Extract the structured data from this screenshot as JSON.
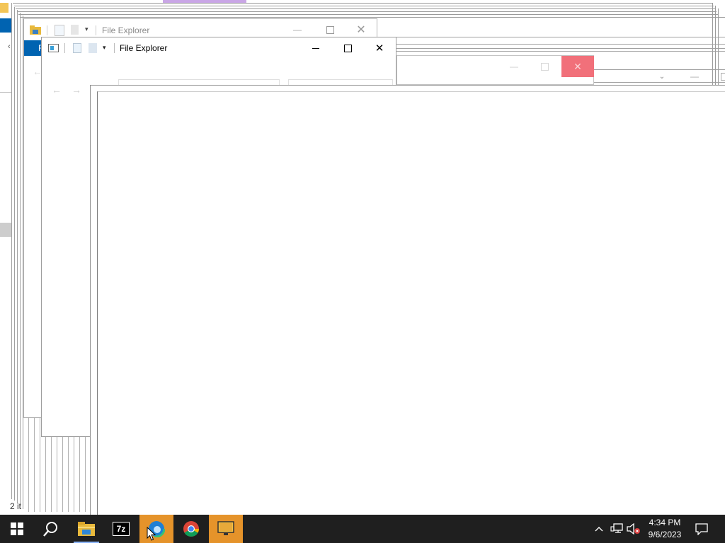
{
  "windows": {
    "back_window": {
      "title": "File Explorer",
      "menu_letter": "F"
    },
    "front_window": {
      "title": "File Explorer"
    },
    "status_text": "2 it"
  },
  "taskbar": {
    "apps": [
      {
        "name": "File Explorer",
        "icon": "folder-icon"
      },
      {
        "name": "7-Zip",
        "icon": "7zip-icon",
        "label": "7z"
      },
      {
        "name": "Microsoft Edge",
        "icon": "edge-icon"
      },
      {
        "name": "Google Chrome",
        "icon": "chrome-icon"
      },
      {
        "name": "Remote Desktop",
        "icon": "monitor-icon"
      }
    ],
    "clock": {
      "time": "4:34 PM",
      "date": "9/6/2023"
    }
  },
  "colors": {
    "taskbar_bg": "#1f1f1f",
    "active_app": "#e5932a",
    "close_hover": "#f1707a",
    "accent_blue": "#0063b1"
  }
}
